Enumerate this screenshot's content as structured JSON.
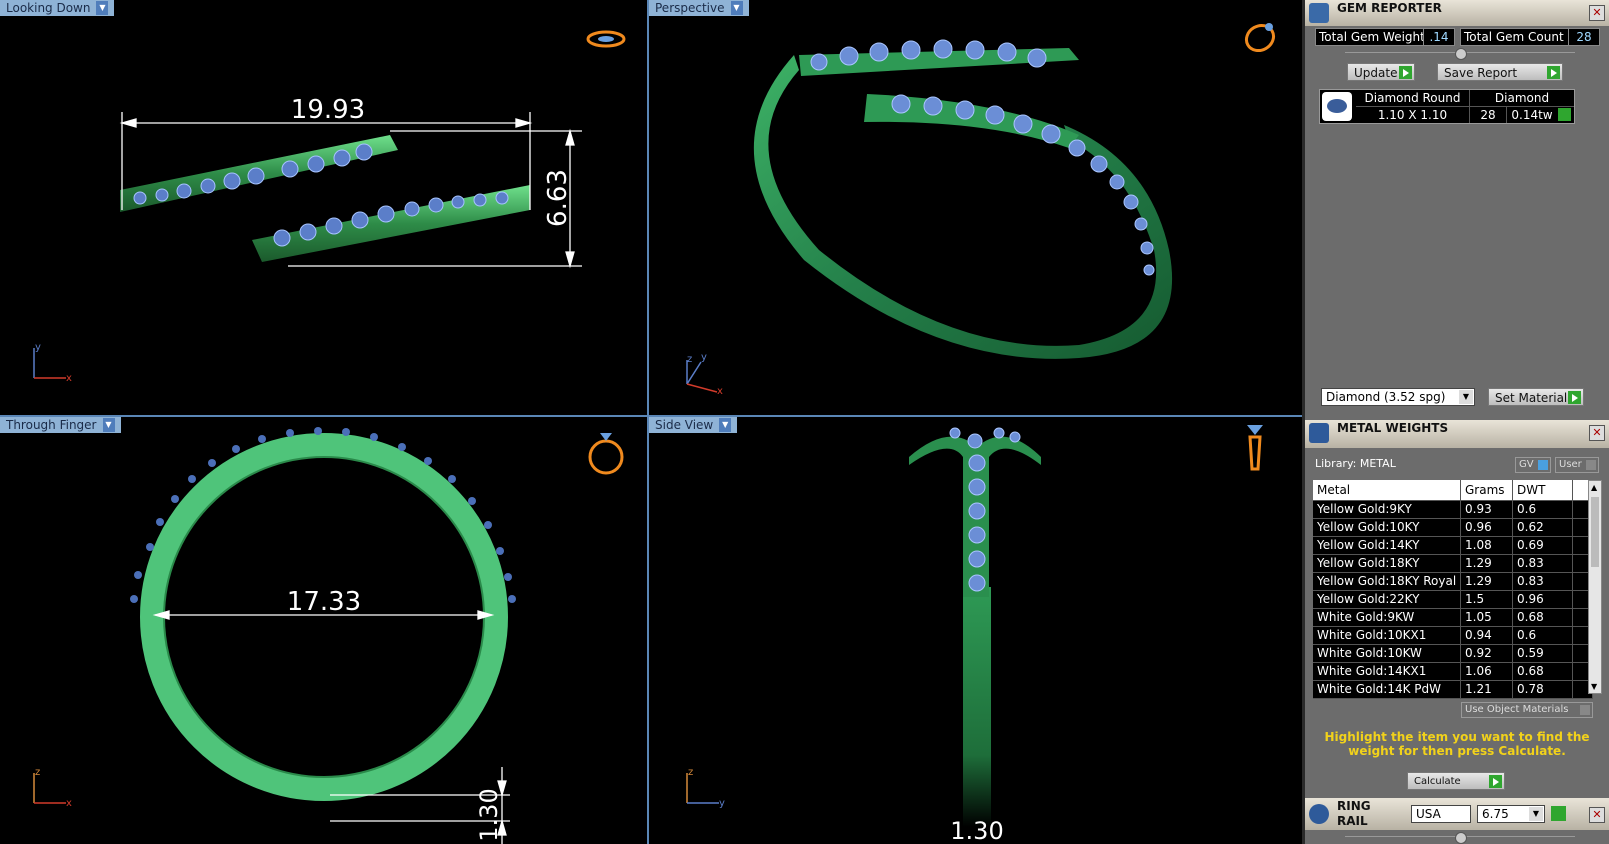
{
  "viewports": {
    "top_left": {
      "label": "Looking Down",
      "dim_width": "19.93",
      "dim_height": "6.63",
      "axis_v": "y",
      "axis_h": "x"
    },
    "top_right": {
      "label": "Perspective",
      "axis_a": "z",
      "axis_b": "y",
      "axis_c": "x"
    },
    "bottom_left": {
      "label": "Through Finger",
      "dim_inner": "17.33",
      "dim_thick": "1.30",
      "axis_v": "z",
      "axis_h": "x"
    },
    "bottom_right": {
      "label": "Side View",
      "dim_width": "1.30",
      "axis_v": "z",
      "axis_h": "y"
    }
  },
  "gem_reporter": {
    "title": "GEM REPORTER",
    "total_weight_label": "Total Gem Weight",
    "total_weight_value": ".14",
    "total_count_label": "Total Gem Count",
    "total_count_value": "28",
    "update_label": "Update",
    "save_report_label": "Save Report",
    "row": {
      "shape": "Diamond Round",
      "size": "1.10 X 1.10",
      "type": "Diamond",
      "count": "28",
      "weight": "0.14tw"
    },
    "material_select": "Diamond     (3.52 spg)",
    "set_material_label": "Set Material"
  },
  "metal_weights": {
    "title": "METAL WEIGHTS",
    "library_label": "Library: METAL",
    "gv_label": "GV",
    "user_label": "User",
    "headers": [
      "Metal",
      "Grams",
      "DWT"
    ],
    "rows": [
      [
        "Yellow Gold:9KY",
        "0.93",
        "0.6"
      ],
      [
        "Yellow Gold:10KY",
        "0.96",
        "0.62"
      ],
      [
        "Yellow Gold:14KY",
        "1.08",
        "0.69"
      ],
      [
        "Yellow Gold:18KY",
        "1.29",
        "0.83"
      ],
      [
        "Yellow Gold:18KY Royal",
        "1.29",
        "0.83"
      ],
      [
        "Yellow Gold:22KY",
        "1.5",
        "0.96"
      ],
      [
        "White Gold:9KW",
        "1.05",
        "0.68"
      ],
      [
        "White Gold:10KX1",
        "0.94",
        "0.6"
      ],
      [
        "White Gold:10KW",
        "0.92",
        "0.59"
      ],
      [
        "White Gold:14KX1",
        "1.06",
        "0.68"
      ],
      [
        "White Gold:14K PdW",
        "1.21",
        "0.78"
      ]
    ],
    "use_object_materials_label": "Use Object Materials",
    "hint": "Highlight the item you want to find the weight for then press Calculate.",
    "calculate_label": "Calculate"
  },
  "ring_rail": {
    "title": "RING RAIL",
    "region": "USA",
    "size": "6.75"
  }
}
